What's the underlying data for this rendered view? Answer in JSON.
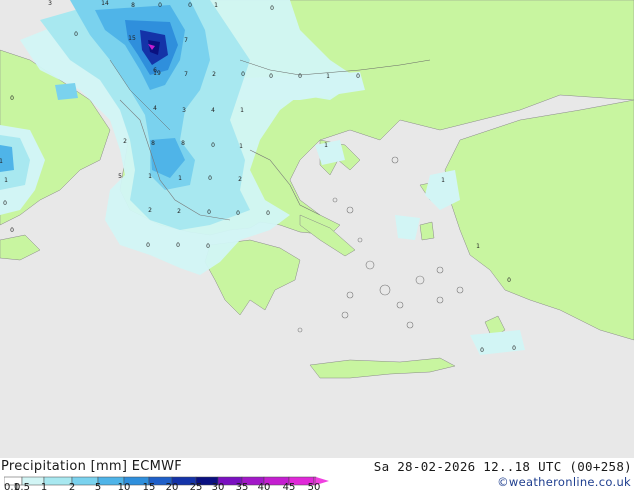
{
  "footer": {
    "title": "Precipitation [mm]  ECMWF",
    "datetime": "Sa 28-02-2026 12..18 UTC (00+258)",
    "credit": "©weatheronline.co.uk"
  },
  "legend": {
    "ticks": [
      "0.1",
      "0.5",
      "1",
      "2",
      "5",
      "10",
      "15",
      "20",
      "25",
      "30",
      "35",
      "40",
      "45",
      "50"
    ],
    "colors": [
      "#ffffff",
      "#d2f5f5",
      "#a8e8f0",
      "#7ad2ee",
      "#4fb4e8",
      "#2f8fdc",
      "#1f5fc8",
      "#1433a8",
      "#0a1080",
      "#7a10c0",
      "#a218c8",
      "#c41ed0",
      "#e028d8",
      "#f040e0"
    ]
  },
  "colors": {
    "sea": "#e8e8e8",
    "land": "#c8f5a0",
    "precip_light": "#d2f5f5",
    "precip_mid": "#a8e8f0",
    "precip_heavy": "#4fb4e8",
    "precip_max": "#1433a8"
  },
  "map_values": [
    "3",
    "14",
    "8",
    "0",
    "0",
    "1",
    "0",
    "0",
    "15",
    "7",
    "6",
    "19",
    "7",
    "2",
    "0",
    "0",
    "0",
    "1",
    "0",
    "0",
    "4",
    "3",
    "4",
    "1",
    "2",
    "8",
    "8",
    "0",
    "1",
    "1",
    "1",
    "5",
    "1",
    "1",
    "0",
    "2",
    "2",
    "2",
    "0",
    "0",
    "0",
    "0",
    "1",
    "1",
    "1",
    "0",
    "0",
    "0",
    "0",
    "0",
    "0",
    "0"
  ]
}
